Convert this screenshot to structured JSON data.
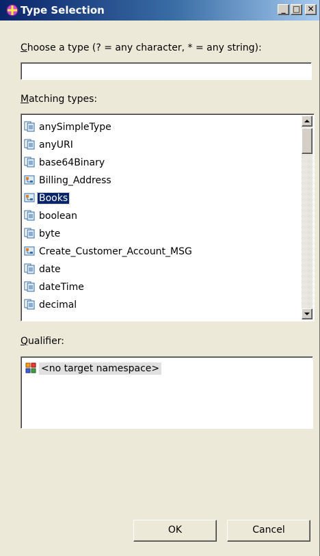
{
  "window": {
    "title": "Type Selection",
    "buttons": {
      "minimize": "_",
      "maximize": "□",
      "close": "✕"
    }
  },
  "filter": {
    "label_accel": "C",
    "label_rest": "hoose a type (? = any character, * = any string):",
    "value": ""
  },
  "matching": {
    "label_accel": "M",
    "label_rest": "atching types:",
    "items": [
      {
        "label": "anySimpleType",
        "icon": "simple-type-icon"
      },
      {
        "label": "anyURI",
        "icon": "simple-type-icon"
      },
      {
        "label": "base64Binary",
        "icon": "simple-type-icon"
      },
      {
        "label": "Billing_Address",
        "icon": "complex-type-icon"
      },
      {
        "label": "Books",
        "icon": "complex-type-icon",
        "selected": true
      },
      {
        "label": "boolean",
        "icon": "simple-type-icon"
      },
      {
        "label": "byte",
        "icon": "simple-type-icon"
      },
      {
        "label": "Create_Customer_Account_MSG",
        "icon": "complex-type-icon"
      },
      {
        "label": "date",
        "icon": "simple-type-icon"
      },
      {
        "label": "dateTime",
        "icon": "simple-type-icon"
      },
      {
        "label": "decimal",
        "icon": "simple-type-icon"
      }
    ]
  },
  "qualifier": {
    "label_accel": "Q",
    "label_rest": "ualifier:",
    "items": [
      {
        "label": "<no target namespace>",
        "icon": "namespace-icon"
      }
    ]
  },
  "buttons": {
    "ok": "OK",
    "cancel": "Cancel"
  },
  "colors": {
    "selection": "#0a246a",
    "title_start": "#0a246a",
    "title_end": "#a6caf0",
    "dialog_bg": "#ece9d8"
  }
}
